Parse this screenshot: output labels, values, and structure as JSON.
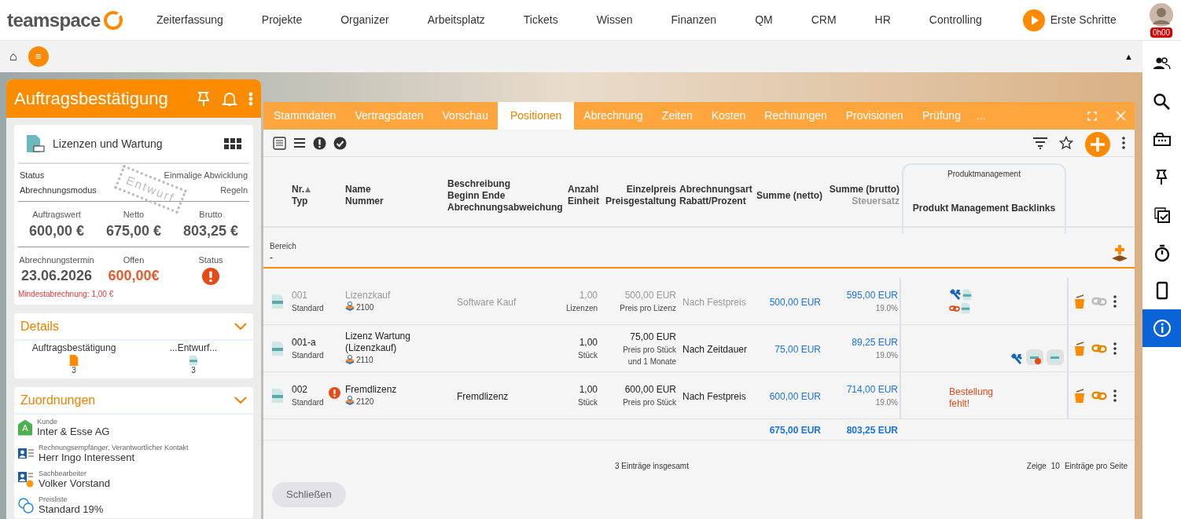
{
  "nav": {
    "logo": "teamspace",
    "items": [
      "Zeiterfassung",
      "Projekte",
      "Organizer",
      "Arbeitsplatz",
      "Tickets",
      "Wissen",
      "Finanzen",
      "QM",
      "CRM",
      "HR",
      "Controlling"
    ],
    "cta": "Erste Schritte",
    "timer": "0h00"
  },
  "toolbar": {
    "home": "⌂",
    "menu": "≡",
    "collapse": "▲"
  },
  "rail": [
    {
      "kind": "people",
      "selected": false
    },
    {
      "kind": "search",
      "selected": false
    },
    {
      "kind": "cards",
      "selected": false
    },
    {
      "kind": "pin",
      "selected": false
    },
    {
      "kind": "tasks",
      "selected": false
    },
    {
      "kind": "timer",
      "selected": false
    },
    {
      "kind": "phone",
      "selected": false
    },
    {
      "kind": "info",
      "selected": true
    }
  ],
  "panel": {
    "title": "Auftragsbestätigung",
    "card": {
      "title": "Lizenzen und Wartung",
      "stamp": "Entwurf",
      "props": [
        {
          "label": "Status",
          "value": "Einmalige Abwicklung"
        },
        {
          "label": "Abrechnungsmodus",
          "value": "Regeln"
        }
      ],
      "figures": [
        {
          "label": "Auftragswert",
          "value": "600,00 €",
          "kind": "plain"
        },
        {
          "label": "Netto",
          "value": "675,00 €",
          "kind": "plain"
        },
        {
          "label": "Brutto",
          "value": "803,25 €",
          "kind": "plain"
        }
      ],
      "figures_2": [
        {
          "label": "Abrechnungstermin",
          "value": "23.06.2026",
          "kind": "plain"
        },
        {
          "label": "Offen",
          "value": "600,00€",
          "kind": "alert"
        },
        {
          "label": "Status",
          "kind": "error-icon"
        }
      ],
      "note": "Mindestabrechnung: 1,00 €"
    },
    "details": {
      "title": "Details",
      "expanded": true,
      "items": [
        {
          "label": "Auftragsbestätigung",
          "count": "3",
          "kind": "orange-doc"
        },
        {
          "label": "...Entwurf...",
          "count": "3",
          "kind": "doc"
        }
      ]
    },
    "assignments": {
      "title": "Zuordnungen",
      "expanded": true,
      "items": [
        {
          "kind": "customer",
          "badge": "A",
          "label": "Kunde",
          "value": "Inter & Esse AG"
        },
        {
          "kind": "contact",
          "label": "Rechnungsempfänger, Verantwortlicher Kontakt",
          "value": "Herr Ingo Interessent"
        },
        {
          "kind": "clerk",
          "label": "Sachbearbeiter",
          "value": "Volker Vorstand"
        },
        {
          "kind": "pricelist",
          "label": "Preisliste",
          "value": "Standard 19%"
        }
      ]
    }
  },
  "dialog": {
    "tabs": [
      {
        "label": "Stammdaten",
        "selected": false
      },
      {
        "label": "Vertragsdaten",
        "selected": false
      },
      {
        "label": "Vorschau",
        "selected": false
      },
      {
        "label": "Positionen",
        "selected": true
      },
      {
        "label": "Abrechnung",
        "selected": false
      },
      {
        "label": "Zeiten",
        "selected": false
      },
      {
        "label": "Kosten",
        "selected": false
      },
      {
        "label": "Rechnungen",
        "selected": false
      },
      {
        "label": "Provisionen",
        "selected": false
      },
      {
        "label": "Prüfung",
        "selected": false
      }
    ],
    "more": "...",
    "group_header": "Produktmanagement",
    "columns": [
      {
        "lines": [
          "Nr.",
          "Typ"
        ],
        "sorted": true
      },
      {
        "lines": [
          "Name",
          "Nummer"
        ],
        "sorted": false
      },
      {
        "lines": [
          "Beschreibung",
          "Beginn Ende",
          "Abrechnungsabweichung"
        ],
        "sorted": false
      },
      {
        "lines": [
          "Anzahl",
          "Einheit"
        ],
        "sorted": false
      },
      {
        "lines": [
          "Einzelpreis",
          "Preisgestaltung"
        ],
        "sorted": false
      },
      {
        "lines": [
          "Abrechnungsart",
          "Rabatt/Prozent"
        ],
        "sorted": false
      },
      {
        "lines": [
          "Summe (netto)"
        ],
        "sorted": false
      },
      {
        "lines": [
          "Summe (brutto)",
          "Steuersatz"
        ],
        "sorted": false
      },
      {
        "lines": [
          "Produkt Management Backlinks"
        ],
        "sorted": false
      }
    ],
    "filter": {
      "label": "Bereich",
      "value": "-"
    },
    "rows": [
      {
        "nr": "001",
        "type": "Standard",
        "warning": false,
        "name": "Lizenzkauf",
        "number": "2100",
        "description": "Software Kauf",
        "qty": "1,00",
        "unit": "Lizenzen",
        "price": "500,00 EUR",
        "price_note": "Preis pro Lizenz",
        "billing": "Nach Festpreis",
        "net": "500,00 EUR",
        "gross": "595,00 EUR",
        "tax": "19.0%",
        "dimmed": true,
        "pm": {
          "kind": "stacked"
        },
        "link_active": false
      },
      {
        "nr": "001-a",
        "type": "Standard",
        "warning": false,
        "name": "Lizenz Wartung (Lizenzkauf)",
        "number": "2110",
        "qty": "1,00",
        "unit": "Stück",
        "price": "75,00 EUR",
        "price_note": "Preis pro Stück\nund 1 Monate",
        "billing": "Nach Zeitdauer",
        "net": "75,00 EUR",
        "gross": "89,25 EUR",
        "tax": "19.0%",
        "dimmed": false,
        "pm": {
          "kind": "inline"
        },
        "link_active": true
      },
      {
        "nr": "002",
        "type": "Standard",
        "warning": true,
        "name": "Fremdlizenz",
        "number": "2120",
        "description": "Fremdlizenz",
        "qty": "1,00",
        "unit": "Stück",
        "price": "600,00 EUR",
        "price_note": "Preis pro Stück",
        "billing": "Nach Festpreis",
        "net": "600,00 EUR",
        "gross": "714,00 EUR",
        "tax": "19.0%",
        "dimmed": false,
        "pm": {
          "kind": "note",
          "text": "Bestellung fehlt!"
        },
        "link_active": true
      }
    ],
    "totals": {
      "net": "675,00 EUR",
      "gross": "803,25 EUR"
    },
    "footer": {
      "count": "3 Einträge insgesamt",
      "show": "Zeige",
      "page_size": "10",
      "per_page": "Einträge pro Seite"
    },
    "close_button": "Schließen"
  }
}
